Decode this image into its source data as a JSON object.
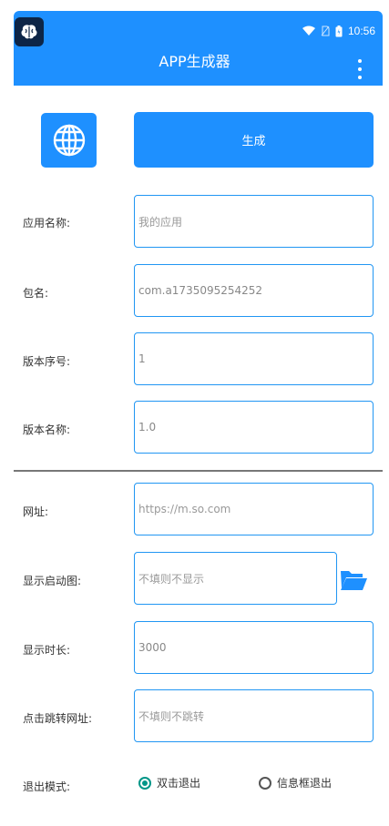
{
  "status_bar": {
    "time": "10:56"
  },
  "app_bar": {
    "title": "APP生成器"
  },
  "actions": {
    "generate_label": "生成"
  },
  "form": {
    "app_name": {
      "label": "应用名称:",
      "placeholder": "我的应用"
    },
    "package": {
      "label": "包名:",
      "value": "com.a1735095254252"
    },
    "version_code": {
      "label": "版本序号:",
      "value": "1"
    },
    "version_name": {
      "label": "版本名称:",
      "value": "1.0"
    },
    "url": {
      "label": "网址:",
      "placeholder": "https://m.so.com"
    },
    "splash": {
      "label": "显示启动图:",
      "placeholder": "不填则不显示"
    },
    "duration": {
      "label": "显示时长:",
      "value": "3000"
    },
    "click_url": {
      "label": "点击跳转网址:",
      "placeholder": "不填则不跳转"
    },
    "exit_mode": {
      "label": "退出模式:",
      "options": [
        "双击退出",
        "信息框退出"
      ],
      "selected": "双击退出"
    }
  },
  "colors": {
    "primary": "#1e90ff",
    "field_border": "#2196f3",
    "radio_checked": "#009688"
  },
  "icons": [
    "brain-icon",
    "wifi-icon",
    "no-sim-icon",
    "battery-icon",
    "more-vert-icon",
    "globe-icon",
    "folder-open-icon"
  ]
}
